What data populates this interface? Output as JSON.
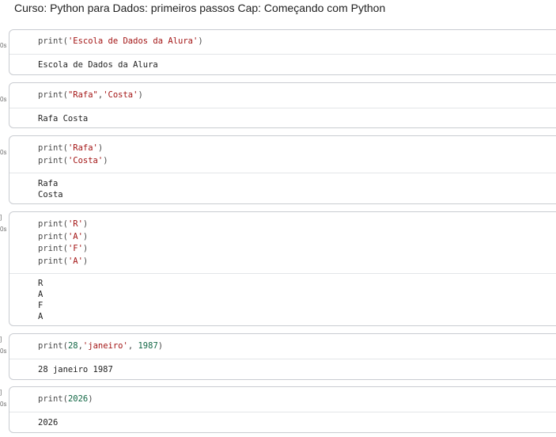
{
  "header": {
    "title": "Curso: Python para Dados: primeiros passos Cap: Começando com Python"
  },
  "cells": [
    {
      "gutter": [
        "0s"
      ],
      "code": [
        [
          {
            "t": "print(",
            "c": "fn"
          },
          {
            "t": "'Escola de Dados da Alura'",
            "c": "str"
          },
          {
            "t": ")",
            "c": "punc"
          }
        ]
      ],
      "output": [
        "Escola de Dados da Alura"
      ]
    },
    {
      "gutter": [
        "0s"
      ],
      "code": [
        [
          {
            "t": "print(",
            "c": "fn"
          },
          {
            "t": "\"Rafa\"",
            "c": "str"
          },
          {
            "t": ",",
            "c": "punc"
          },
          {
            "t": "'Costa'",
            "c": "str"
          },
          {
            "t": ")",
            "c": "punc"
          }
        ]
      ],
      "output": [
        "Rafa Costa"
      ]
    },
    {
      "gutter": [
        "0s"
      ],
      "code": [
        [
          {
            "t": "print(",
            "c": "fn"
          },
          {
            "t": "'Rafa'",
            "c": "str"
          },
          {
            "t": ")",
            "c": "punc"
          }
        ],
        [
          {
            "t": "print(",
            "c": "fn"
          },
          {
            "t": "'Costa'",
            "c": "str"
          },
          {
            "t": ")",
            "c": "punc"
          }
        ]
      ],
      "output": [
        "Rafa",
        "Costa"
      ]
    },
    {
      "gutter": [
        "]",
        "0s"
      ],
      "code": [
        [
          {
            "t": "print(",
            "c": "fn"
          },
          {
            "t": "'R'",
            "c": "str"
          },
          {
            "t": ")",
            "c": "punc"
          }
        ],
        [
          {
            "t": "print(",
            "c": "fn"
          },
          {
            "t": "'A'",
            "c": "str"
          },
          {
            "t": ")",
            "c": "punc"
          }
        ],
        [
          {
            "t": "print(",
            "c": "fn"
          },
          {
            "t": "'F'",
            "c": "str"
          },
          {
            "t": ")",
            "c": "punc"
          }
        ],
        [
          {
            "t": "print(",
            "c": "fn"
          },
          {
            "t": "'A'",
            "c": "str"
          },
          {
            "t": ")",
            "c": "punc"
          }
        ]
      ],
      "output": [
        "R",
        "A",
        "F",
        "A"
      ]
    },
    {
      "gutter": [
        "]",
        "0s"
      ],
      "code": [
        [
          {
            "t": "print(",
            "c": "fn"
          },
          {
            "t": "28",
            "c": "num"
          },
          {
            "t": ",",
            "c": "punc"
          },
          {
            "t": "'janeiro'",
            "c": "str"
          },
          {
            "t": ", ",
            "c": "punc"
          },
          {
            "t": "1987",
            "c": "num"
          },
          {
            "t": ")",
            "c": "punc"
          }
        ]
      ],
      "output": [
        "28 janeiro 1987"
      ]
    },
    {
      "gutter": [
        "]",
        "0s"
      ],
      "code": [
        [
          {
            "t": "print(",
            "c": "fn"
          },
          {
            "t": "2026",
            "c": "num"
          },
          {
            "t": ")",
            "c": "punc"
          }
        ]
      ],
      "output": [
        "2026"
      ]
    }
  ]
}
